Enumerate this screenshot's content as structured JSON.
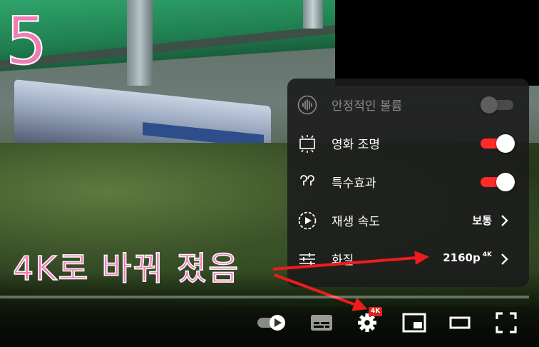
{
  "overlay": {
    "step_number": "5",
    "annotation": "4K로 바꿔 졌음"
  },
  "settings_menu": {
    "items": [
      {
        "label": "안정적인 볼륨",
        "icon": "stable-volume-icon",
        "control": "toggle",
        "state": "off",
        "disabled": true
      },
      {
        "label": "영화 조명",
        "icon": "ambient-mode-icon",
        "control": "toggle",
        "state": "on"
      },
      {
        "label": "특수효과",
        "icon": "annotations-icon",
        "control": "toggle",
        "state": "on"
      },
      {
        "label": "재생 속도",
        "icon": "playback-speed-icon",
        "control": "submenu",
        "value": "보통"
      },
      {
        "label": "화질",
        "icon": "quality-icon",
        "control": "submenu",
        "value": "2160p",
        "badge": "4K"
      }
    ]
  },
  "controls": {
    "autoplay_icon": "autoplay-toggle-icon",
    "subtitles_icon": "subtitles-icon",
    "settings_icon": "gear-icon",
    "settings_badge": "4K",
    "miniplayer_icon": "miniplayer-icon",
    "theater_icon": "theater-mode-icon",
    "fullscreen_icon": "fullscreen-icon"
  },
  "colors": {
    "accent_red": "#ff2a2a",
    "annotation_pink": "#f07cb6",
    "panel_bg": "#1c1c1c"
  }
}
